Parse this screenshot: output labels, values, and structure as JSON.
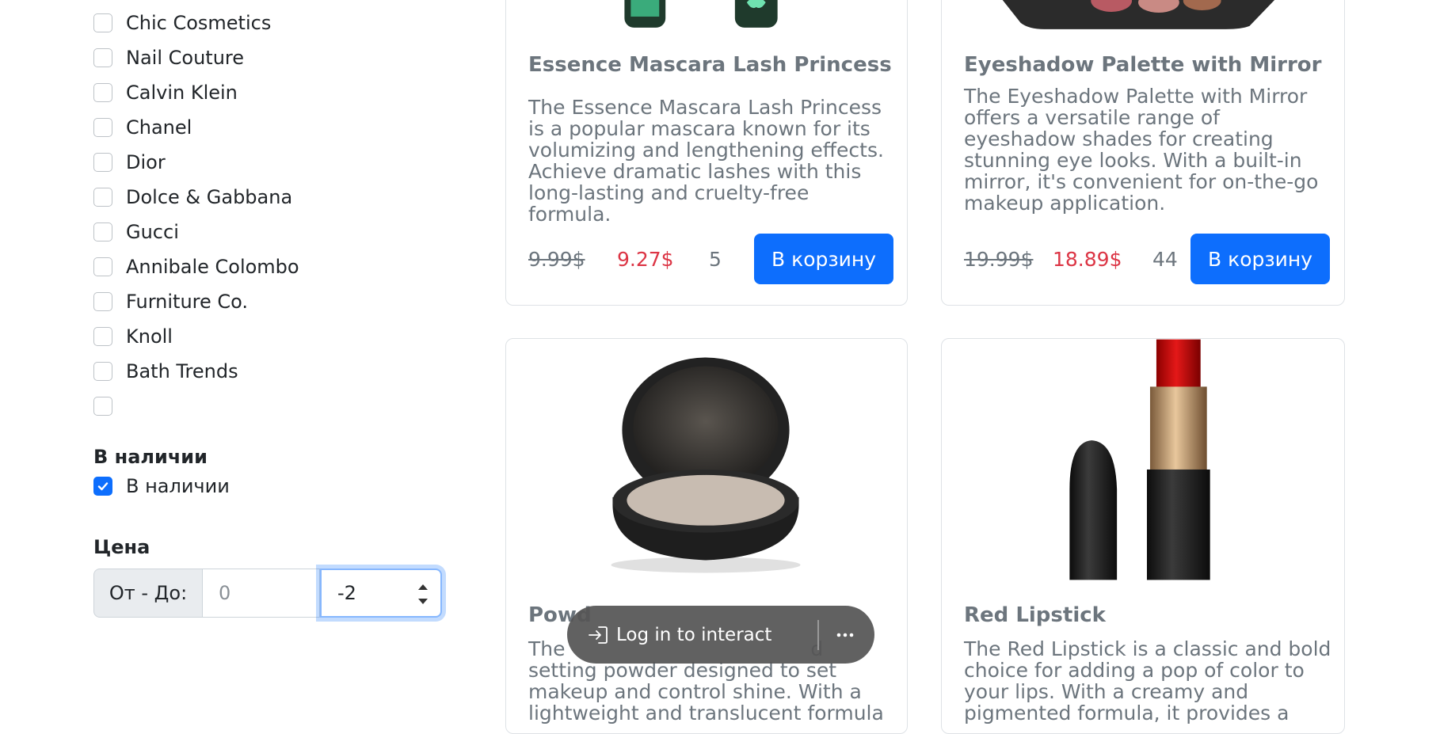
{
  "filters": {
    "brands": [
      {
        "label": "Chic Cosmetics",
        "checked": false
      },
      {
        "label": "Nail Couture",
        "checked": false
      },
      {
        "label": "Calvin Klein",
        "checked": false
      },
      {
        "label": "Chanel",
        "checked": false
      },
      {
        "label": "Dior",
        "checked": false
      },
      {
        "label": "Dolce & Gabbana",
        "checked": false
      },
      {
        "label": "Gucci",
        "checked": false
      },
      {
        "label": "Annibale Colombo",
        "checked": false
      },
      {
        "label": "Furniture Co.",
        "checked": false
      },
      {
        "label": "Knoll",
        "checked": false
      },
      {
        "label": "Bath Trends",
        "checked": false
      },
      {
        "label": "",
        "checked": false
      }
    ],
    "availability": {
      "heading": "В наличии",
      "label": "В наличии",
      "checked": true
    },
    "price": {
      "heading": "Цена",
      "range_label": "От - До:",
      "from_placeholder": "0",
      "to_value": "-2"
    }
  },
  "products": [
    {
      "title": "Essence Mascara Lash Princess",
      "description": "The Essence Mascara Lash Princess is a popular mascara known for its volumizing and lengthening effects. Achieve dramatic lashes with this long-lasting and cruelty-free formula.",
      "old_price": "9.99$",
      "new_price": "9.27$",
      "stock": "5",
      "cart_label": "В корзину"
    },
    {
      "title": "Eyeshadow Palette with Mirror",
      "description": "The Eyeshadow Palette with Mirror offers a versatile range of eyeshadow shades for creating stunning eye looks. With a built-in mirror, it's convenient for on-the-go makeup application.",
      "old_price": "19.99$",
      "new_price": "18.89$",
      "stock": "44",
      "cart_label": "В корзину"
    },
    {
      "title": "Powd",
      "description": "The                                       d setting powder designed to set makeup and control shine. With a lightweight and translucent formula"
    },
    {
      "title": "Red Lipstick",
      "description": "The Red Lipstick is a classic and bold choice for adding a pop of color to your lips. With a creamy and pigmented formula, it provides a"
    }
  ],
  "overlay": {
    "login_label": "Log in to interact",
    "login_icon": "sign-in-icon",
    "more_icon": "more-horizontal-icon"
  },
  "colors": {
    "primary": "#0d6efd",
    "sale_price": "#dc3545",
    "muted_text": "#6c757d"
  }
}
